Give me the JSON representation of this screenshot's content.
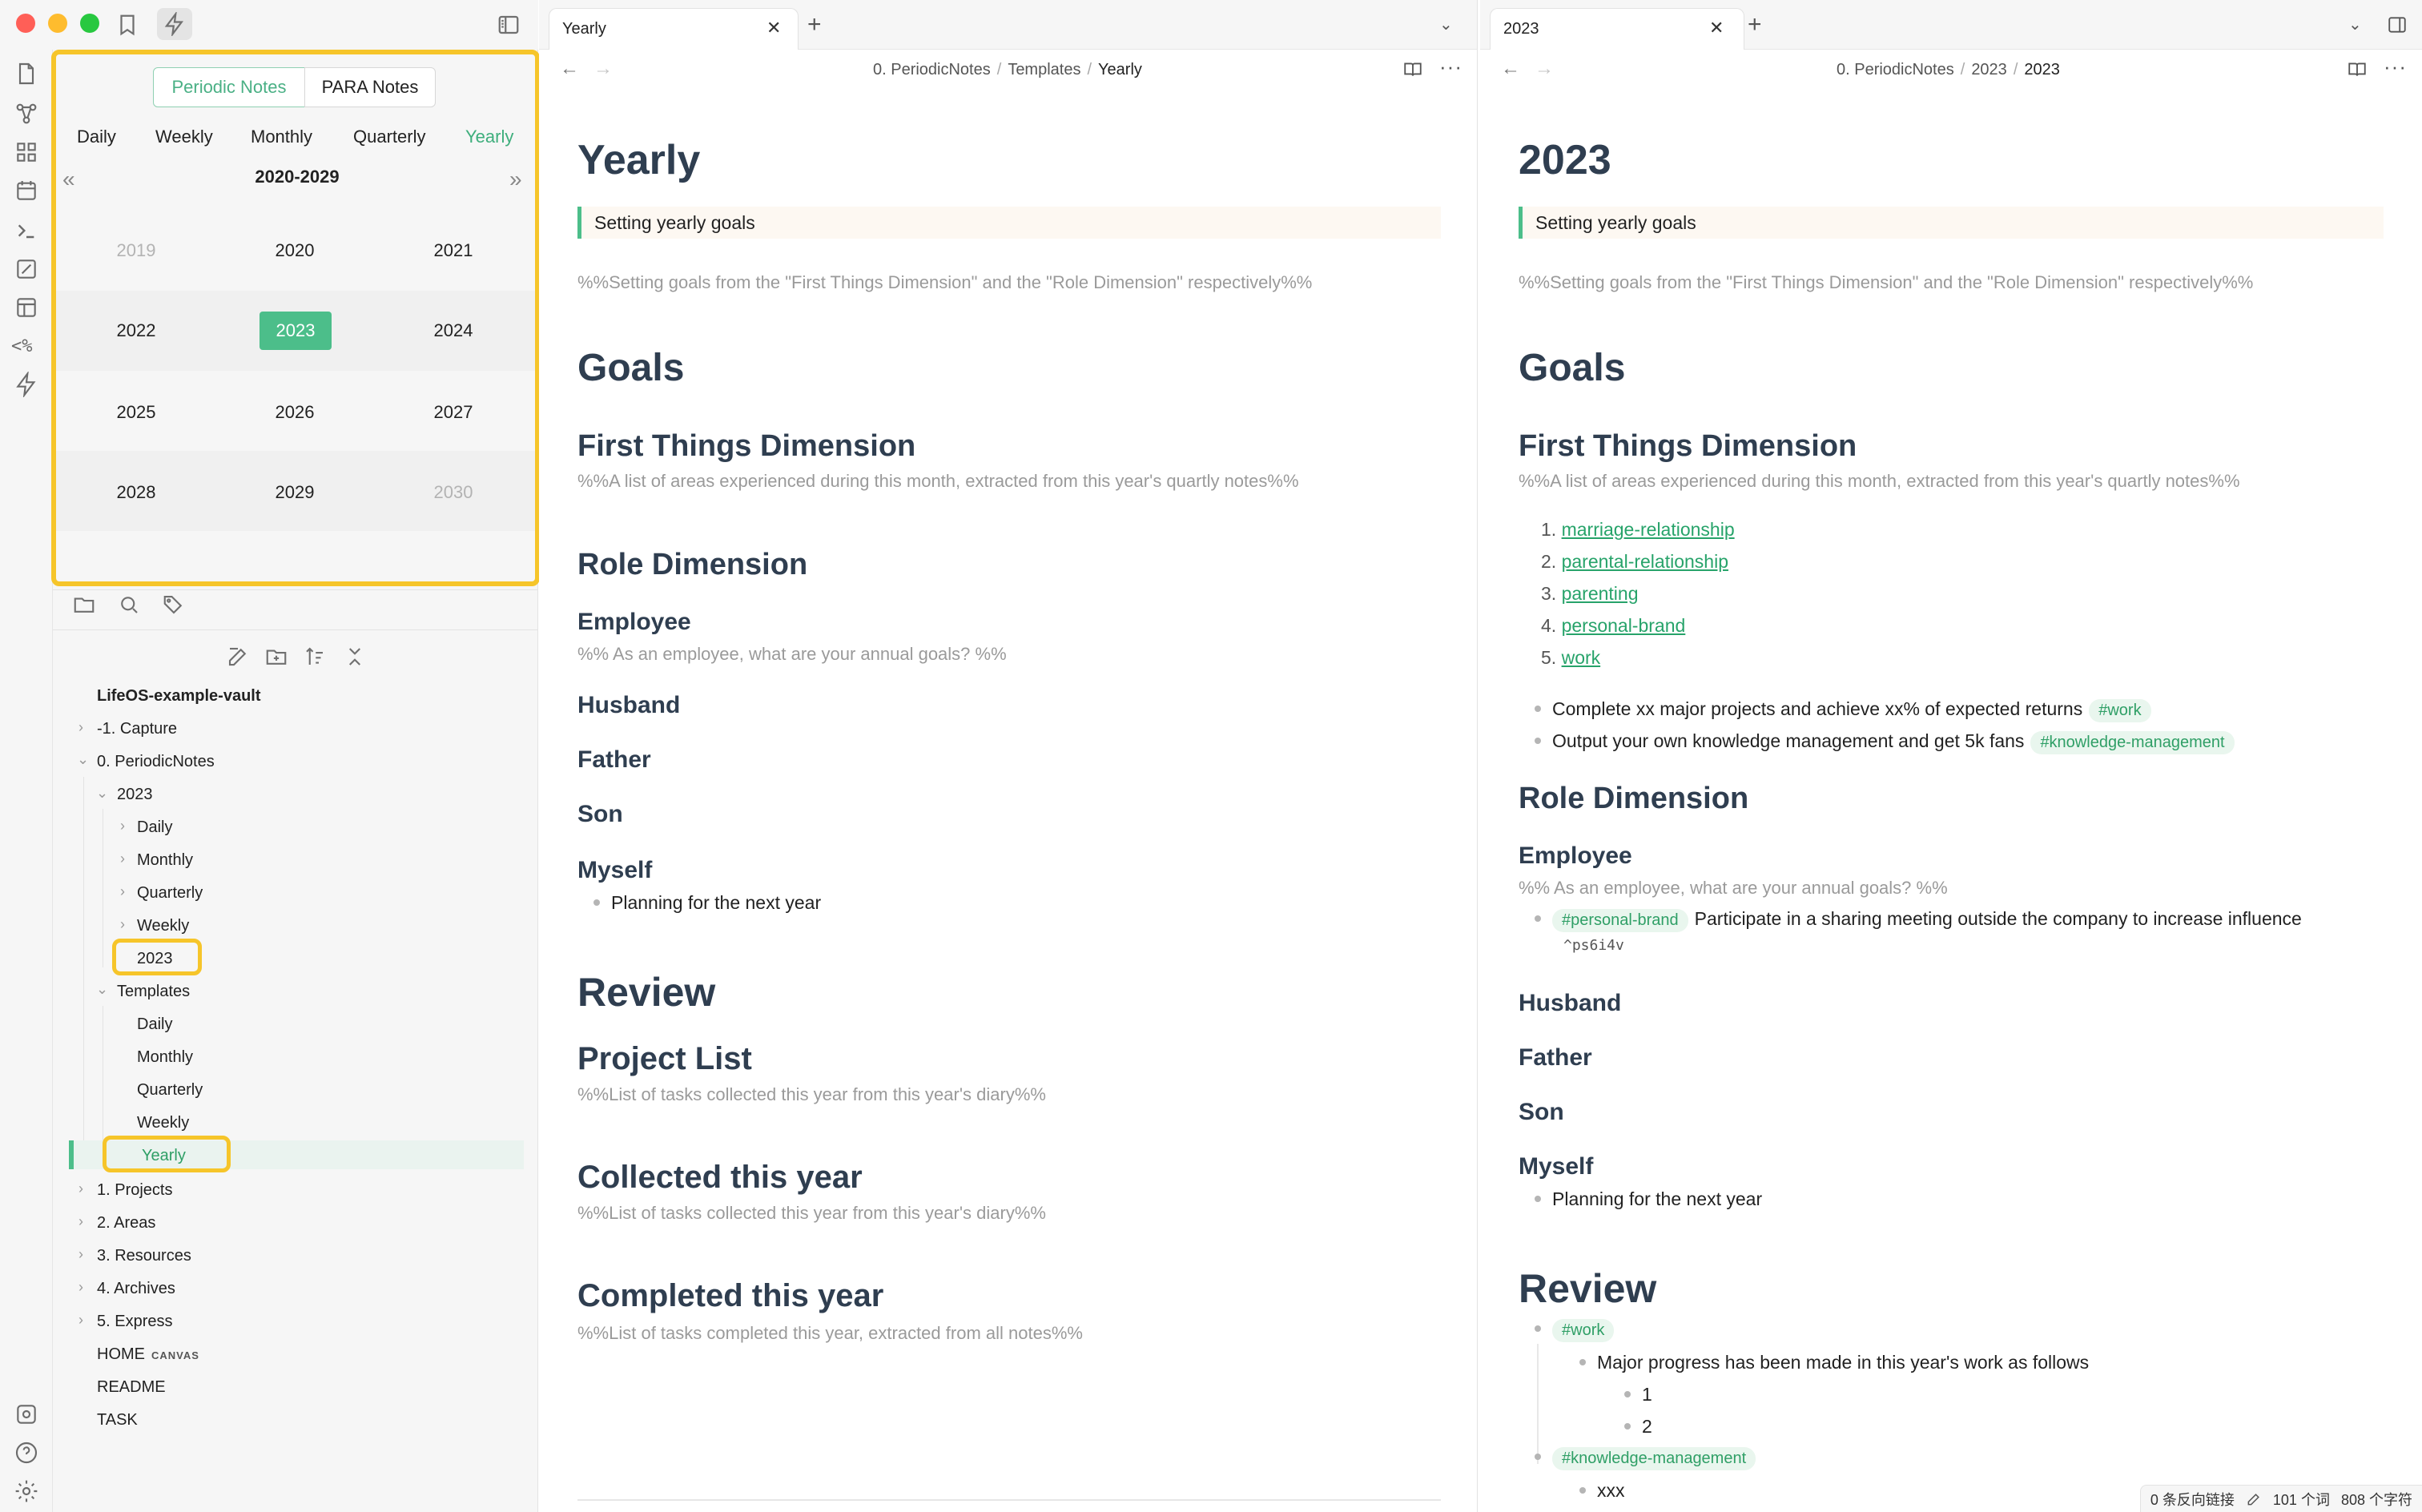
{
  "colors": {
    "accent": "#4cbe8a",
    "highlight": "#f6c52a",
    "heading": "#2f3e50",
    "comment": "#9a9a9a",
    "tag_bg": "#e9f6ee"
  },
  "ribbon": {
    "template_icon_text": "<%"
  },
  "calendar": {
    "plugin_tabs": [
      "Periodic Notes",
      "PARA Notes"
    ],
    "period_tabs": [
      "Daily",
      "Weekly",
      "Monthly",
      "Quarterly",
      "Yearly"
    ],
    "active_period": "Yearly",
    "decade_label": "2020-2029",
    "prev": "«",
    "next": "»",
    "years": [
      [
        "2019",
        "2020",
        "2021"
      ],
      [
        "2022",
        "2023",
        "2024"
      ],
      [
        "2025",
        "2026",
        "2027"
      ],
      [
        "2028",
        "2029",
        "2030"
      ]
    ],
    "selected_year": "2023"
  },
  "tree": {
    "vault": "LifeOS-example-vault",
    "items": {
      "capture": "-1. Capture",
      "periodic": "0. PeriodicNotes",
      "y2023": "2023",
      "daily": "Daily",
      "monthly": "Monthly",
      "quarterly": "Quarterly",
      "weekly": "Weekly",
      "note2023": "2023",
      "templates": "Templates",
      "t_daily": "Daily",
      "t_monthly": "Monthly",
      "t_quarterly": "Quarterly",
      "t_weekly": "Weekly",
      "t_yearly": "Yearly",
      "projects": "1. Projects",
      "areas": "2. Areas",
      "resources": "3. Resources",
      "archives": "4. Archives",
      "express": "5. Express",
      "home": "HOME",
      "home_tag": "CANVAS",
      "readme": "README",
      "task": "TASK"
    }
  },
  "left_pane": {
    "tab_title": "Yearly",
    "close": "✕",
    "plus": "+",
    "menu": "⌄",
    "breadcrumb": [
      "0. PeriodicNotes",
      "Templates",
      "Yearly"
    ],
    "crumb_sep": "/",
    "doc": {
      "title": "Yearly",
      "callout": "Setting yearly goals",
      "comment1": "%%Setting goals from the \"First Things Dimension\" and the \"Role Dimension\" respectively%%",
      "goals": "Goals",
      "first_things": "First Things Dimension",
      "ft_comment": "%%A list of areas experienced during this month, extracted from this year's quartly notes%%",
      "role": "Role Dimension",
      "employee": "Employee",
      "employee_comment": "%% As an employee, what are your annual goals? %%",
      "husband": "Husband",
      "father": "Father",
      "son": "Son",
      "myself": "Myself",
      "myself_bullet": "Planning for the next year",
      "review": "Review",
      "project_list": "Project List",
      "project_comment": "%%List of tasks collected this year from this year's diary%%",
      "collected": "Collected this year",
      "collected_comment": "%%List of tasks collected this year from this year's diary%%",
      "completed": "Completed this year",
      "completed_comment": "%%List of tasks completed this year, extracted from all notes%%"
    }
  },
  "right_pane": {
    "tab_title": "2023",
    "close": "✕",
    "plus": "+",
    "menu": "⌄",
    "breadcrumb": [
      "0. PeriodicNotes",
      "2023",
      "2023"
    ],
    "crumb_sep": "/",
    "doc": {
      "title": "2023",
      "callout": "Setting yearly goals",
      "comment1": "%%Setting goals from the \"First Things Dimension\" and the \"Role Dimension\" respectively%%",
      "goals": "Goals",
      "first_things": "First Things Dimension",
      "ft_comment": "%%A list of areas experienced during this month, extracted from this year's quartly notes%%",
      "areas_list": [
        {
          "num": "1.",
          "link": "marriage-relationship"
        },
        {
          "num": "2.",
          "link": "parental-relationship"
        },
        {
          "num": "3.",
          "link": "parenting"
        },
        {
          "num": "4.",
          "link": "personal-brand"
        },
        {
          "num": "5.",
          "link": "work"
        }
      ],
      "goal1": "Complete xx major projects and achieve xx% of expected returns",
      "goal1_tag": "#work",
      "goal2": "Output your own knowledge management and get 5k fans",
      "goal2_tag": "#knowledge-management",
      "role": "Role Dimension",
      "employee": "Employee",
      "employee_comment": "%% As an employee, what are your annual goals? %%",
      "employee_tag": "#personal-brand",
      "employee_goal": "Participate in a sharing meeting outside the company to increase influence",
      "block_id": "^ps6i4v",
      "husband": "Husband",
      "father": "Father",
      "son": "Son",
      "myself": "Myself",
      "myself_bullet": "Planning for the next year",
      "review": "Review",
      "review_tag1": "#work",
      "review_progress": "Major progress has been made in this year's work as follows",
      "review_n1": "1",
      "review_n2": "2",
      "review_tag2": "#knowledge-management",
      "review_xxx": "xxx"
    },
    "status": {
      "backlinks": "0 条反向链接",
      "words": "101 个词",
      "chars": "808 个字符"
    }
  }
}
